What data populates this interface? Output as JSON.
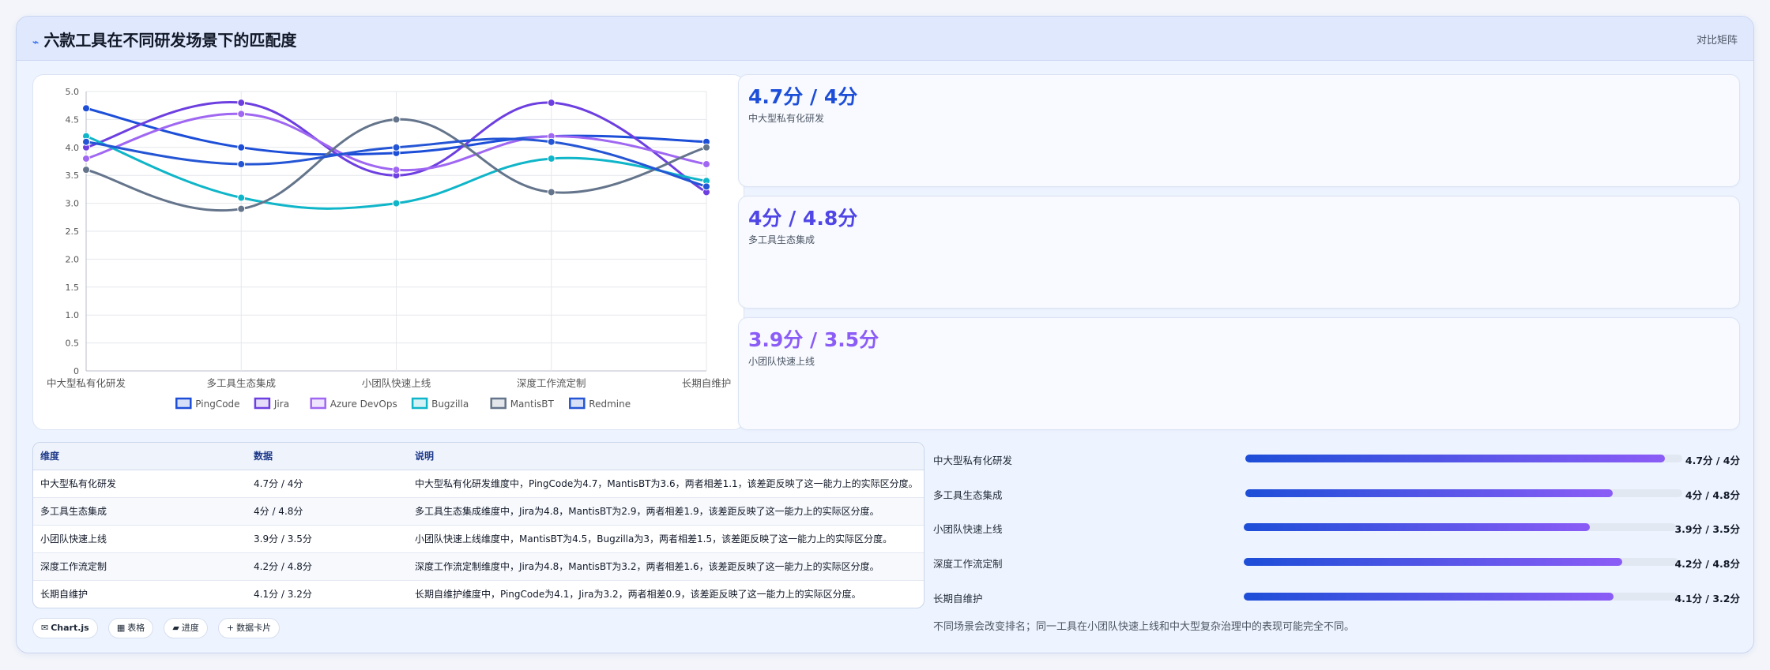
{
  "header": {
    "title": "六款工具在不同研发场景下的匹配度",
    "tag": "对比矩阵"
  },
  "kpis": [
    {
      "value": "4.7分 / 4分",
      "label": "中大型私有化研发",
      "color": "#1d4ed8"
    },
    {
      "value": "4分 / 4.8分",
      "label": "多工具生态集成",
      "color": "#4f46e5"
    },
    {
      "value": "3.9分 / 3.5分",
      "label": "小团队快速上线",
      "color": "#8b5cf6"
    }
  ],
  "chart_data": {
    "type": "line",
    "categories": [
      "中大型私有化研发",
      "多工具生态集成",
      "小团队快速上线",
      "深度工作流定制",
      "长期自维护"
    ],
    "yticks": [
      "0",
      "0.5",
      "1.0",
      "1.5",
      "2.0",
      "2.5",
      "3.0",
      "3.5",
      "4.0",
      "4.5",
      "5.0"
    ],
    "ylim": [
      0,
      5
    ],
    "grid": true,
    "legend_position": "bottom",
    "series": [
      {
        "name": "PingCode",
        "values": [
          4.7,
          4.0,
          3.9,
          4.2,
          4.1
        ],
        "color": "#1d4ed8"
      },
      {
        "name": "Jira",
        "values": [
          4.0,
          4.8,
          3.5,
          4.8,
          3.2
        ],
        "color": "#6d3fe0"
      },
      {
        "name": "Azure DevOps",
        "values": [
          3.8,
          4.6,
          3.6,
          4.2,
          3.7
        ],
        "color": "#9f67f2"
      },
      {
        "name": "Bugzilla",
        "values": [
          4.2,
          3.1,
          3.0,
          3.8,
          3.4
        ],
        "color": "#0fb5c8"
      },
      {
        "name": "MantisBT",
        "values": [
          3.6,
          2.9,
          4.5,
          3.2,
          4.0
        ],
        "color": "#64748b"
      },
      {
        "name": "Redmine",
        "values": [
          4.1,
          3.7,
          4.0,
          4.1,
          3.3
        ],
        "color": "#2455d4"
      }
    ]
  },
  "table": {
    "headers": [
      "维度",
      "数据",
      "说明"
    ],
    "rows": [
      [
        "中大型私有化研发",
        "4.7分 / 4分",
        "中大型私有化研发维度中，PingCode为4.7，MantisBT为3.6，两者相差1.1，该差距反映了这一能力上的实际区分度。"
      ],
      [
        "多工具生态集成",
        "4分 / 4.8分",
        "多工具生态集成维度中，Jira为4.8，MantisBT为2.9，两者相差1.9，该差距反映了这一能力上的实际区分度。"
      ],
      [
        "小团队快速上线",
        "3.9分 / 3.5分",
        "小团队快速上线维度中，MantisBT为4.5，Bugzilla为3，两者相差1.5，该差距反映了这一能力上的实际区分度。"
      ],
      [
        "深度工作流定制",
        "4.2分 / 4.8分",
        "深度工作流定制维度中，Jira为4.8，MantisBT为3.2，两者相差1.6，该差距反映了这一能力上的实际区分度。"
      ],
      [
        "长期自维护",
        "4.1分 / 3.2分",
        "长期自维护维度中，PingCode为4.1，Jira为3.2，两者相差0.9，该差距反映了这一能力上的实际区分度。"
      ]
    ]
  },
  "progress": [
    {
      "label": "中大型私有化研发",
      "value": "4.7分 / 4分",
      "fraction": 0.96
    },
    {
      "label": "多工具生态集成",
      "value": "4分 / 4.8分",
      "fraction": 0.84
    },
    {
      "label": "小团队快速上线",
      "value": "3.9分 / 3.5分",
      "fraction": 0.8
    },
    {
      "label": "深度工作流定制",
      "value": "4.2分 / 4.8分",
      "fraction": 0.87
    },
    {
      "label": "长期自维护",
      "value": "4.1分 / 3.2分",
      "fraction": 0.85
    }
  ],
  "note": "不同场景会改变排名；同一工具在小团队快速上线和中大型复杂治理中的表现可能完全不同。",
  "chips": [
    {
      "icon": "✉",
      "label": "Chart.js"
    },
    {
      "icon": "▦",
      "label": "表格"
    },
    {
      "icon": "▰",
      "label": "进度"
    },
    {
      "icon": "+",
      "label": "数据卡片"
    }
  ]
}
